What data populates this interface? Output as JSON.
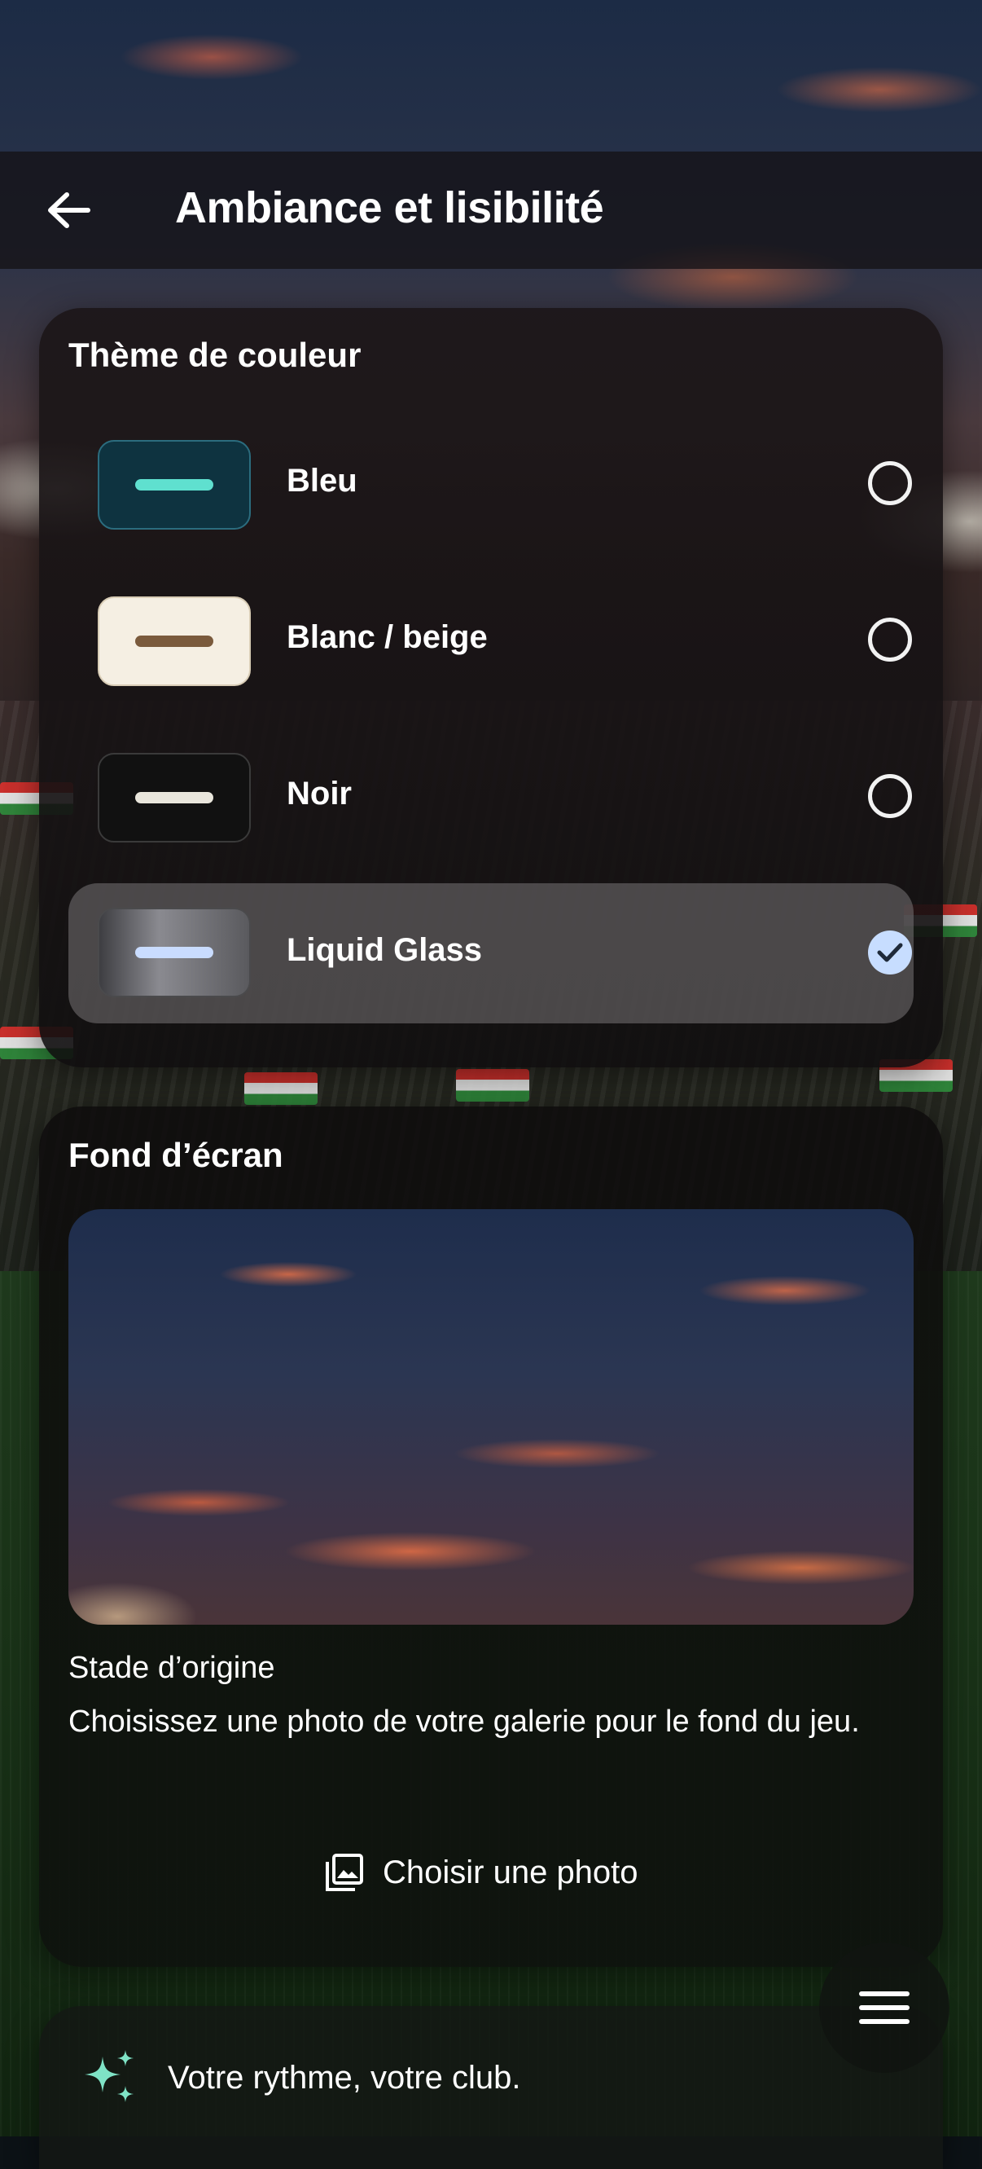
{
  "header": {
    "title": "Ambiance et lisibilité",
    "back_icon": "arrow-left-icon"
  },
  "theme_section": {
    "title": "Thème de couleur",
    "options": [
      {
        "label": "Bleu",
        "swatch_bg": "#0e3340",
        "swatch_border": "#2b6c7e",
        "bar_color": "#5fe0cf",
        "selected": false
      },
      {
        "label": "Blanc / beige",
        "swatch_bg": "#f5efe3",
        "swatch_border": "#d9cdb6",
        "bar_color": "#7a5a3c",
        "selected": false
      },
      {
        "label": "Noir",
        "swatch_bg": "#111111",
        "swatch_border": "#3a3a3a",
        "bar_color": "#e9e6dc",
        "selected": false
      },
      {
        "label": "Liquid Glass",
        "swatch_bg": "#5a5a5e",
        "swatch_border": "#4a4a4c",
        "bar_color": "#c9dcff",
        "selected": true
      }
    ]
  },
  "wallpaper_section": {
    "title": "Fond d’écran",
    "current_name": "Stade d’origine",
    "description": "Choisissez une photo de votre galerie pour le fond du jeu.",
    "choose_label": "Choisir une photo",
    "choose_icon": "photo-library-icon"
  },
  "footer": {
    "tagline": "Votre rythme, votre club.",
    "icon": "sparkles-icon"
  },
  "menu_icon": "hamburger-menu-icon",
  "colors": {
    "accent_check": "#c7ddff",
    "sparkle": "#7fe3c6"
  }
}
